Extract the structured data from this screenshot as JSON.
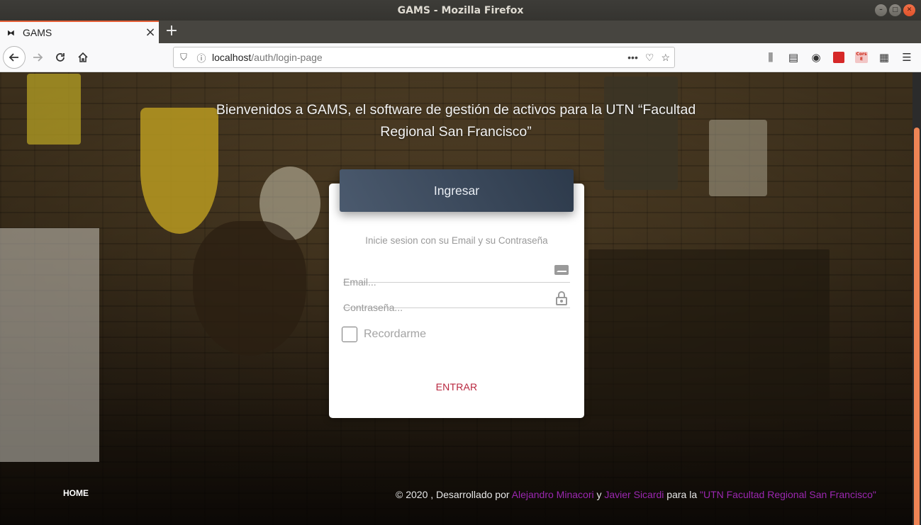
{
  "window": {
    "title": "GAMS - Mozilla Firefox"
  },
  "tab": {
    "label": "GAMS"
  },
  "urlbar": {
    "host": "localhost",
    "path": "/auth/login-page"
  },
  "extensions": {
    "cors_label": "Cors E"
  },
  "page": {
    "welcome": "Bienvenidos a GAMS, el software de gestión de activos para la UTN “Facultad Regional San Francisco”",
    "login": {
      "header": "Ingresar",
      "description": "Inicie sesion con su Email y su Contraseña",
      "email_placeholder": "Email...",
      "password_placeholder": "Contraseña...",
      "remember_label": "Recordarme",
      "submit_label": "ENTRAR"
    },
    "footer": {
      "home": "HOME",
      "copy_prefix": "© 2020 , Desarrollado por",
      "author1": "Alejandro Minacori",
      "and": "y",
      "author2": "Javier Sicardi",
      "for": "para la",
      "institution": "\"UTN Facultad Regional San Francisco\""
    }
  },
  "colors": {
    "accent_tab": "#e66037",
    "link": "#9b27b0",
    "submit": "#b8263e",
    "header": "#3d4a5c"
  }
}
